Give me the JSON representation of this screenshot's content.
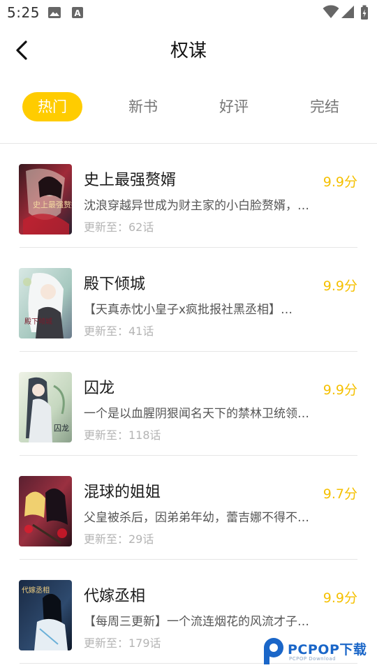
{
  "status_bar": {
    "time": "5:25"
  },
  "header": {
    "title": "权谋"
  },
  "tabs": [
    {
      "label": "热门",
      "active": true
    },
    {
      "label": "新书",
      "active": false
    },
    {
      "label": "好评",
      "active": false
    },
    {
      "label": "完结",
      "active": false
    }
  ],
  "colors": {
    "accent": "#ffcc00",
    "score": "#f5c000"
  },
  "books": [
    {
      "title": "史上最强赘婿",
      "score": "9.9分",
      "desc": "沈浪穿越异世成为财主家的小白脸赘婿，…",
      "update": "更新至：62话",
      "cover_text": "史上最强赘婿"
    },
    {
      "title": "殿下倾城",
      "score": "9.9分",
      "desc": "【天真赤忱小皇子x疯批报社黑丞相】…",
      "update": "更新至：41话",
      "cover_text": "殿下倾城"
    },
    {
      "title": "囚龙",
      "score": "9.9分",
      "desc": "一个是以血腥阴狠闻名天下的禁林卫统领…",
      "update": "更新至：118话",
      "cover_text": "囚龙"
    },
    {
      "title": "混球的姐姐",
      "score": "9.7分",
      "desc": "父皇被杀后，因弟弟年幼，蕾吉娜不得不…",
      "update": "更新至：29话",
      "cover_text": ""
    },
    {
      "title": "代嫁丞相",
      "score": "9.9分",
      "desc": "【每周三更新】一个流连烟花的风流才子…",
      "update": "更新至：179话",
      "cover_text": "代嫁丞相"
    }
  ],
  "watermark": {
    "brand": "PCPOP下载",
    "sub": "PCPOP Download"
  }
}
